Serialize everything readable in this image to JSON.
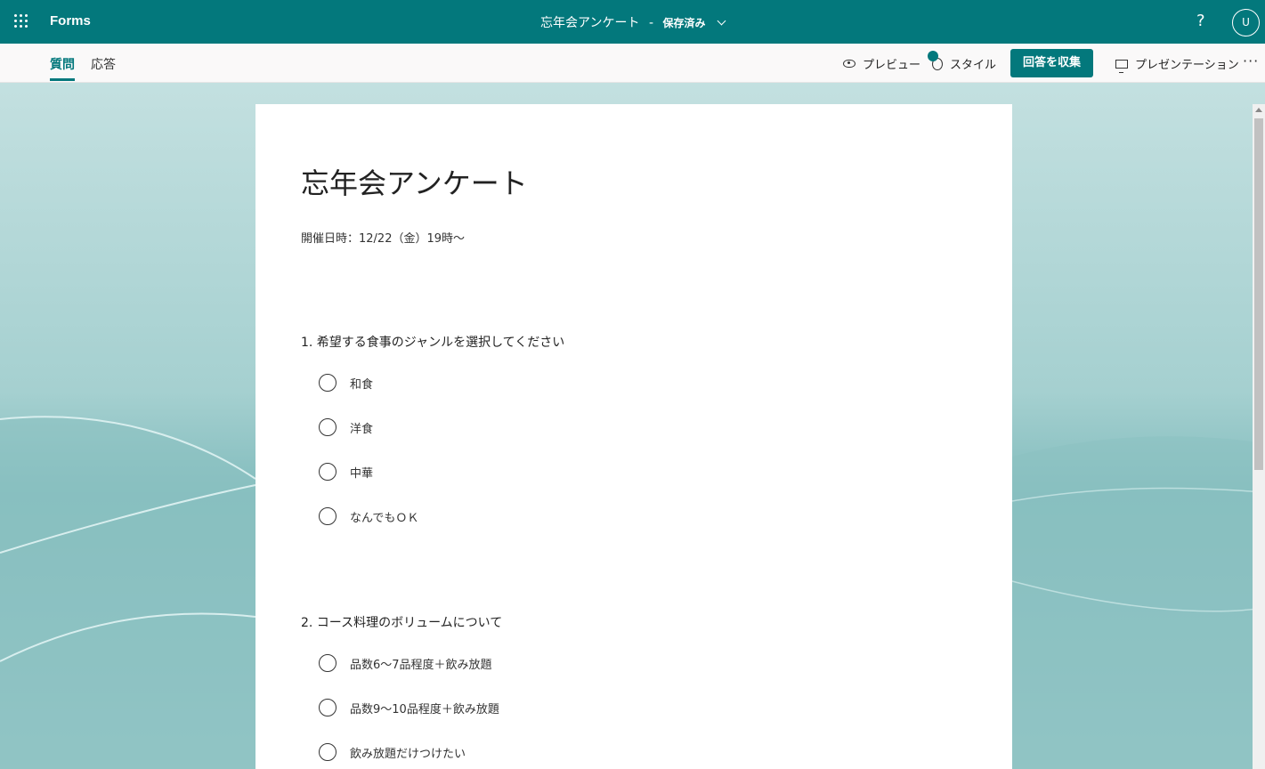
{
  "header": {
    "app_name": "Forms",
    "form_title": "忘年会アンケート",
    "separator": "-",
    "save_status": "保存済み",
    "help_label": "?",
    "avatar_initial": "U"
  },
  "tabs": [
    {
      "label": "質問",
      "active": true
    },
    {
      "label": "応答",
      "active": false
    }
  ],
  "commands": {
    "preview": "プレビュー",
    "style": "スタイル",
    "collect": "回答を収集",
    "present": "プレゼンテーション",
    "more": "···"
  },
  "colors": {
    "accent": "#03787c"
  },
  "form": {
    "title": "忘年会アンケート",
    "description": "開催日時：12/22（金）19時～",
    "questions": [
      {
        "label": "1. 希望する食事のジャンルを選択してください",
        "options": [
          "和食",
          "洋食",
          "中華",
          "なんでもＯＫ"
        ]
      },
      {
        "label": "2. コース料理のボリュームについて",
        "options": [
          "品数6～7品程度＋飲み放題",
          "品数9～10品程度＋飲み放題",
          "飲み放題だけつけたい"
        ]
      }
    ]
  }
}
